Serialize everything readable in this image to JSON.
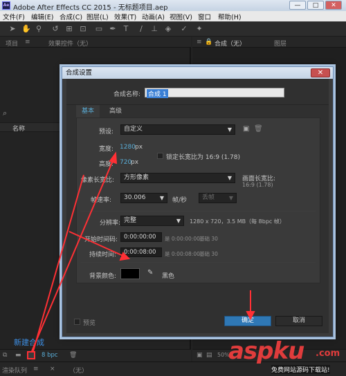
{
  "window": {
    "title": "Adobe After Effects CC 2015 - 无标题项目.aep",
    "logo": "Ae",
    "controls": [
      "—",
      "□",
      "✕"
    ]
  },
  "menu": [
    "文件(F)",
    "编辑(E)",
    "合成(C)",
    "图层(L)",
    "效果(T)",
    "动画(A)",
    "视图(V)",
    "窗口",
    "帮助(H)"
  ],
  "left_panel": {
    "tab_project": "项目",
    "tab_effects": "效果控件（无）",
    "search_icon": "⌕",
    "col_name": "名称",
    "new_comp_annotation": "新建合成",
    "bpc": "8 bpc"
  },
  "right_panel": {
    "tab_comp": "合成（无）",
    "tab_layer": "图层",
    "zoom": "50%"
  },
  "status": {
    "render_queue": "渲染队列",
    "none_tab": "（无）"
  },
  "dialog": {
    "title": "合成设置",
    "comp_name_label": "合成名称:",
    "comp_name_value": "合成 1",
    "tabs": {
      "basic": "基本",
      "advanced": "高级"
    },
    "preset_label": "预设:",
    "preset_value": "自定义",
    "width_label": "宽度:",
    "width_value": "1280",
    "width_unit": "px",
    "height_label": "高度:",
    "height_value": "720",
    "height_unit": "px",
    "lock_aspect": "锁定长宽比为 16:9 (1.78)",
    "pixel_aspect_label": "像素长宽比:",
    "pixel_aspect_value": "方形像素",
    "frame_aspect_label": "画面长宽比:",
    "frame_aspect_value": "16:9 (1.78)",
    "fps_label": "帧速率:",
    "fps_value": "30.006",
    "fps_unit": "帧/秒",
    "drop_frame": "丢帧",
    "resolution_label": "分辨率:",
    "resolution_value": "完整",
    "resolution_info": "1280 x 720，3.5 MB（每 8bpc 帧）",
    "start_label": "开始时间码:",
    "start_value": "0:00:00:00",
    "start_hint": "是 0:00:00:00",
    "start_base": "基础 30",
    "duration_label": "持续时间:",
    "duration_value": "0:00:08:00",
    "duration_hint": "是 0:00:08:00",
    "duration_base": "基础 30",
    "bg_label": "背景颜色:",
    "bg_value": "黑色",
    "bg_color": "#000000",
    "preview_label": "预览",
    "ok": "确定",
    "cancel": "取消"
  },
  "watermark": {
    "brand": "aspku",
    "tld": ".com",
    "tagline": "免费网站源码下载站!"
  },
  "colors": {
    "accent_blue": "#5aaed8",
    "annotation_red": "#ff3035"
  }
}
